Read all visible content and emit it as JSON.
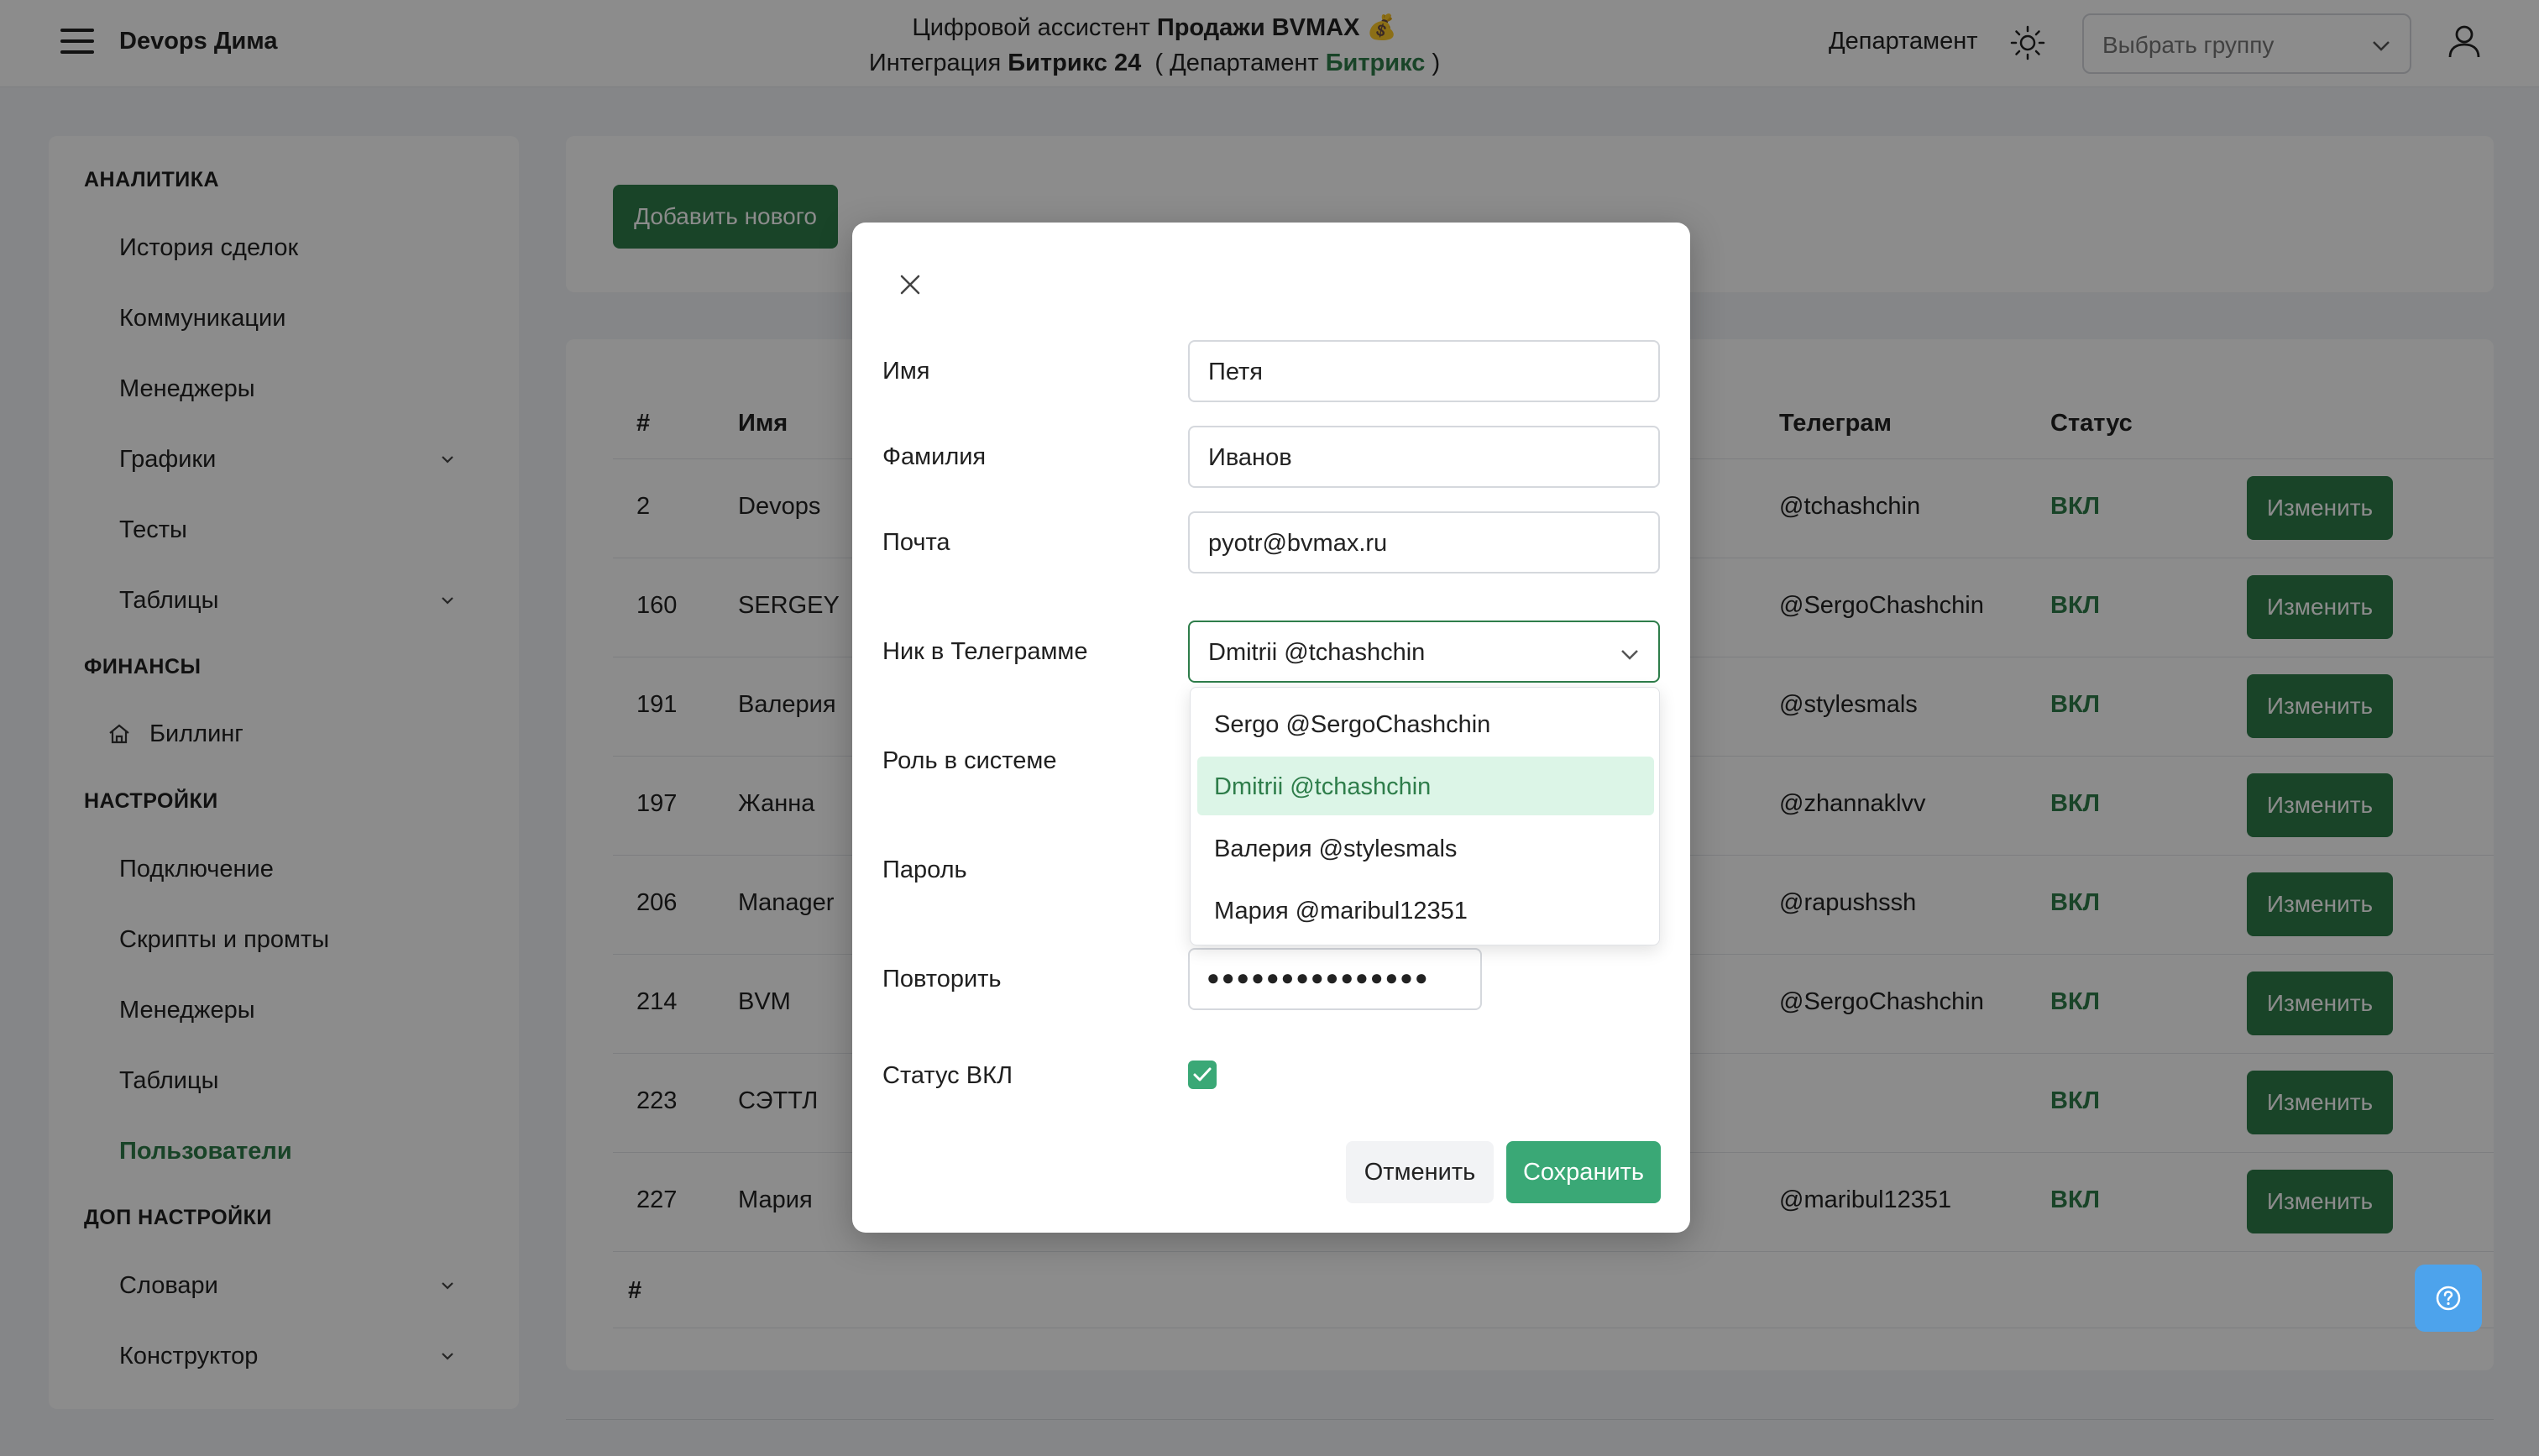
{
  "header": {
    "brand": "Devops Дима",
    "line1_prefix": "Цифровой ассистент",
    "line1_bold": "Продажи BVMAX",
    "line1_emoji": "💰",
    "line2_prefix": "Интеграция",
    "line2_bold": "Битрикс 24",
    "line2_mid": "( Департамент",
    "line2_green": "Битрикс",
    "line2_end": ")",
    "department_label": "Департамент",
    "group_placeholder": "Выбрать группу"
  },
  "sidebar": {
    "analytics_title": "АНАЛИТИКА",
    "analytics": [
      "История сделок",
      "Коммуникации",
      "Менеджеры",
      "Графики",
      "Тесты",
      "Таблицы"
    ],
    "finance_title": "ФИНАНСЫ",
    "billing": "Биллинг",
    "settings_title": "НАСТРОЙКИ",
    "settings": [
      "Подключение",
      "Скрипты и промты",
      "Менеджеры",
      "Таблицы",
      "Пользователи"
    ],
    "extra_title": "ДОП НАСТРОЙКИ",
    "extra": [
      "Словари",
      "Конструктор"
    ]
  },
  "main": {
    "add_button": "Добавить нового",
    "columns": {
      "num": "#",
      "name": "Имя",
      "telegram": "Телеграм",
      "status": "Статус"
    },
    "edit_label": "Изменить",
    "rows": [
      {
        "id": "2",
        "name": "Devops",
        "telegram": "@tchashchin",
        "status": "ВКЛ"
      },
      {
        "id": "160",
        "name": "SERGEY",
        "telegram": "@SergoChashchin",
        "status": "ВКЛ"
      },
      {
        "id": "191",
        "name": "Валерия",
        "telegram": "@stylesmals",
        "status": "ВКЛ"
      },
      {
        "id": "197",
        "name": "Жанна",
        "telegram": "@zhannaklvv",
        "status": "ВКЛ"
      },
      {
        "id": "206",
        "name": "Manager",
        "telegram": "@rapushssh",
        "status": "ВКЛ"
      },
      {
        "id": "214",
        "name": "BVM",
        "telegram": "@SergoChashchin",
        "status": "ВКЛ"
      },
      {
        "id": "223",
        "name": "СЭТТЛ",
        "telegram": "",
        "status": "ВКЛ"
      },
      {
        "id": "227",
        "name": "Мария",
        "telegram": "@maribul12351",
        "status": "ВКЛ"
      }
    ],
    "footer_hash": "#"
  },
  "modal": {
    "first_name_label": "Имя",
    "first_name": "Петя",
    "last_name_label": "Фамилия",
    "last_name": "Иванов",
    "email_label": "Почта",
    "email": "pyotr@bvmax.ru",
    "telegram_label": "Ник в Телеграмме",
    "telegram_selected": "Dmitrii @tchashchin",
    "role_label": "Роль в системе",
    "password_label": "Пароль",
    "repeat_label": "Повторить",
    "repeat_value": "●●●●●●●●●●●●●●●",
    "status_label": "Статус ВКЛ",
    "cancel": "Отменить",
    "save": "Сохранить",
    "options": [
      "Sergo @SergoChashchin",
      "Dmitrii @tchashchin",
      "Валерия @stylesmals",
      "Мария @maribul12351"
    ]
  },
  "colors": {
    "accent": "#2e7d4a",
    "accent_light": "#3aa876",
    "help": "#4da3ec"
  }
}
